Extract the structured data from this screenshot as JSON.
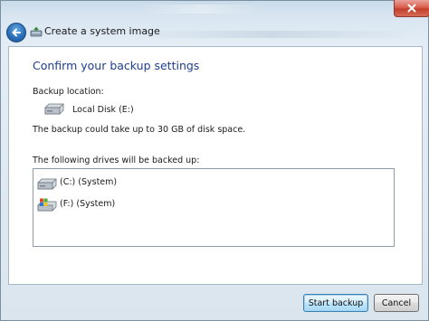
{
  "window": {
    "title": "Create a system image",
    "close_label": "✕"
  },
  "content": {
    "heading": "Confirm your backup settings",
    "backup_location_label": "Backup location:",
    "location_name": "Local Disk (E:)",
    "space_note": "The backup could take up to 30 GB of disk space.",
    "drives_label": "The following drives will be backed up:",
    "drives": [
      {
        "label": "(C:) (System)",
        "icon": "hard-drive-icon"
      },
      {
        "label": "(F:) (System)",
        "icon": "windows-drive-icon"
      }
    ]
  },
  "footer": {
    "start_label": "Start backup",
    "cancel_label": "Cancel"
  },
  "colors": {
    "heading": "#1e3e8c",
    "close_button": "#c3402d",
    "back_button": "#2a6fb9"
  }
}
